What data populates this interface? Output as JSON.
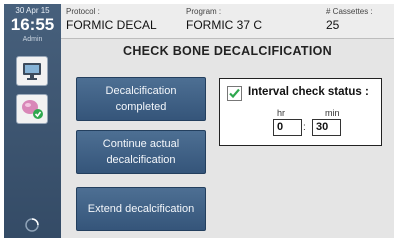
{
  "sidebar": {
    "date": "30 Apr 15",
    "time": "16:55",
    "user": "Admin"
  },
  "header": {
    "protocol_label": "Protocol :",
    "protocol_value": "FORMIC DECAL",
    "program_label": "Program :",
    "program_value": "FORMIC 37 C",
    "cassettes_label": "# Cassettes :",
    "cassettes_value": "25"
  },
  "page_title": "CHECK BONE DECALCIFICATION",
  "buttons": {
    "completed_line1": "Decalcification",
    "completed_line2": "completed",
    "continue_line1": "Continue actual",
    "continue_line2": "decalcification",
    "extend": "Extend decalcification"
  },
  "interval": {
    "label": "Interval check status :",
    "checked": true,
    "hours_label": "hr",
    "hours_value": "0",
    "minutes_label": "min",
    "minutes_value": "30",
    "separator": ":"
  },
  "icons": {
    "monitor": "monitor-icon",
    "reagent": "reagent-check-icon",
    "spinner": "busy-spinner-icon",
    "checkbox": "checkmark-icon"
  },
  "colors": {
    "sidebar": "#3f5773",
    "button": "#3f6186",
    "check_green": "#2fa84f"
  }
}
